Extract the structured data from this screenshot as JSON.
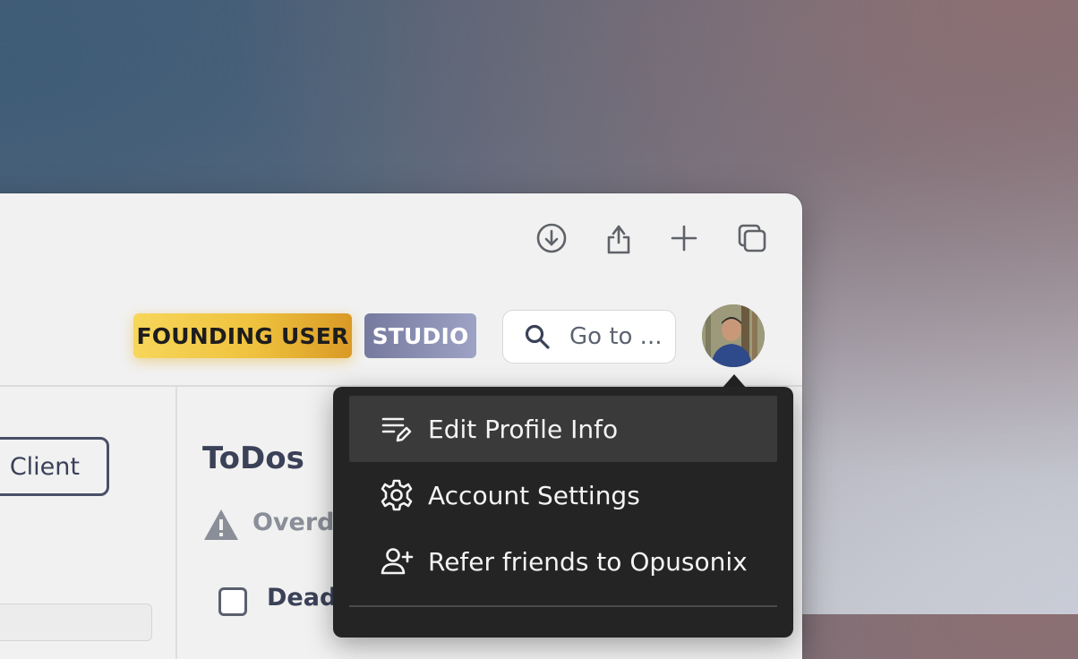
{
  "toolbar": {
    "icons": [
      "download-icon",
      "share-icon",
      "new-tab-icon",
      "tabs-overview-icon"
    ]
  },
  "header": {
    "badge_founding": "FOUNDING USER",
    "badge_studio": "STUDIO",
    "search_placeholder": "Go to ...",
    "colors": {
      "founding_badge": "#efc23e",
      "studio_badge": "#858ab0"
    }
  },
  "left": {
    "client_button": "n Client"
  },
  "todos": {
    "title": "ToDos",
    "overdue_label": "Overdu",
    "item_label": "Deadl"
  },
  "profile_menu": {
    "items": [
      {
        "label": "Edit Profile Info",
        "icon": "edit-list-icon",
        "highlighted": true
      },
      {
        "label": "Account Settings",
        "icon": "gear-icon"
      },
      {
        "label": "Refer friends to Opusonix",
        "icon": "add-user-icon"
      }
    ]
  }
}
